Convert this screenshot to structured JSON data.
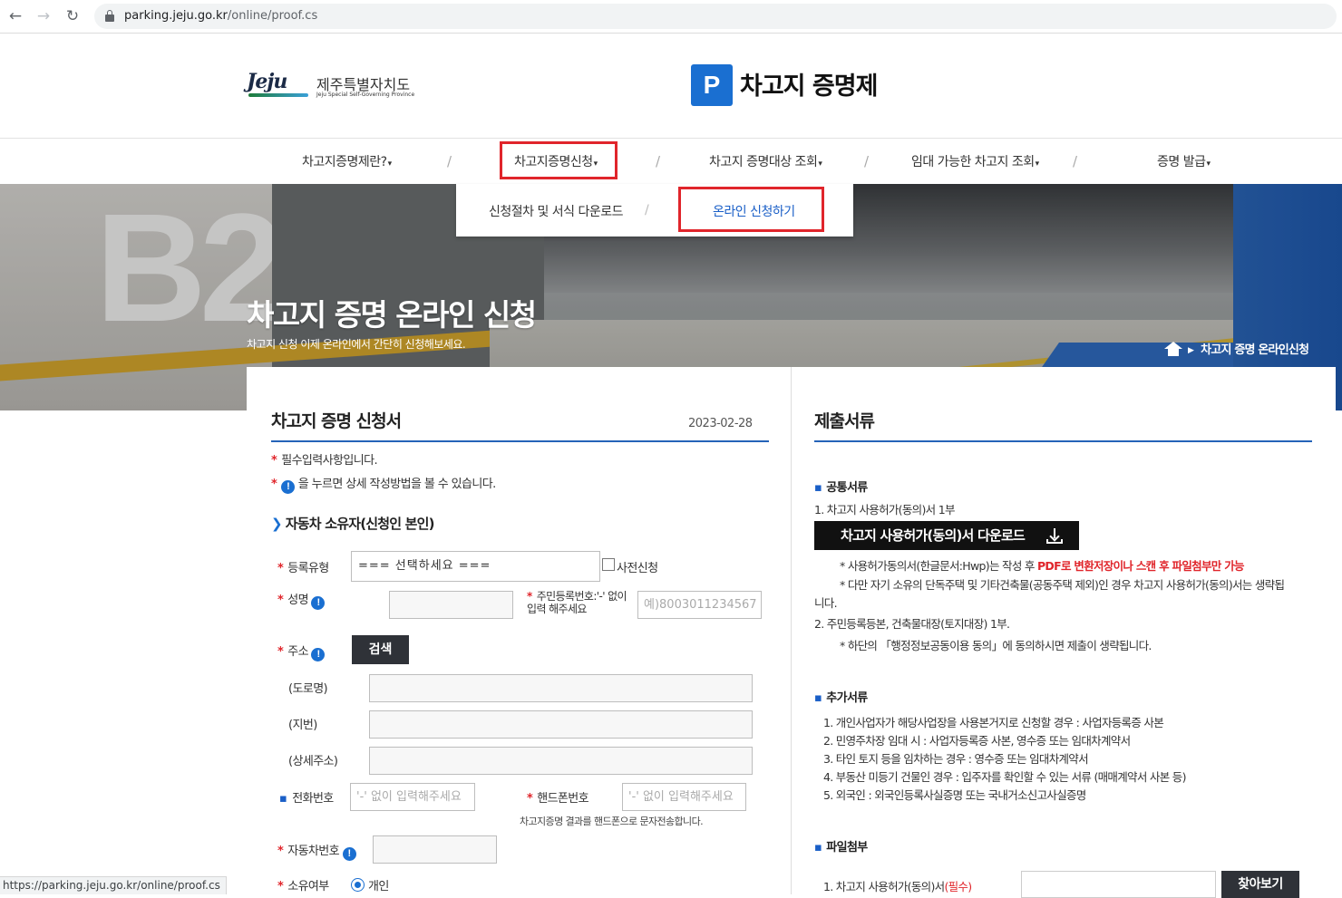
{
  "browser": {
    "url_host": "parking.jeju.go.kr",
    "url_path": "/online/proof.cs"
  },
  "header": {
    "jeju_mark": "Jeju",
    "jeju_org_kr": "제주특별자치도",
    "jeju_org_en": "Jeju Special Self-Governing Province",
    "brand_letter": "P",
    "brand_title": "차고지 증명제"
  },
  "nav": {
    "items": [
      {
        "label": "차고지증명제란?"
      },
      {
        "label": "차고지증명신청"
      },
      {
        "label": "차고지 증명대상 조회"
      },
      {
        "label": "임대 가능한 차고지 조회"
      },
      {
        "label": "증명 발급"
      }
    ],
    "caret": "▾",
    "separator": "/"
  },
  "dropdown": {
    "items": [
      {
        "label": "신청절차 및 서식 다운로드"
      },
      {
        "label": "온라인 신청하기"
      }
    ]
  },
  "hero": {
    "sign_text": "B2",
    "title": "차고지 증명 온라인 신청",
    "subtitle": "차고지 신청 이제 온라인에서 간단히 신청해보세요.",
    "breadcrumb_current": "차고지 증명 온라인신청"
  },
  "form": {
    "title": "차고지 증명 신청서",
    "date": "2023-02-28",
    "note1": "필수입력사항입니다.",
    "note2": "을 누르면 상세 작성방법을 볼 수 있습니다.",
    "info_glyph": "!",
    "section_owner": "자동차 소유자(신청인 본인)",
    "reg_type_label": "등록유형",
    "reg_type_value": "=== 선택하세요 ===",
    "pre_apply_label": "사전신청",
    "name_label": "성명",
    "rrn_label": "주민등록번호:'-' 없이 입력 해주세요",
    "rrn_placeholder": "예)8003011234567",
    "address_label": "주소",
    "search_button": "검색",
    "road_label": "(도로명)",
    "lot_label": "(지번)",
    "detail_label": "(상세주소)",
    "phone_label": "전화번호",
    "phone_placeholder": "'-' 없이 입력해주세요",
    "mobile_label": "핸드폰번호",
    "mobile_placeholder": "'-' 없이 입력해주세요",
    "mobile_note": "차고지증명 결과를 핸드폰으로 문자전송합니다.",
    "car_number_label": "자동차번호",
    "ownership_label": "소유여부",
    "ownership_option": "개인"
  },
  "docs": {
    "title": "제출서류",
    "common_heading": "공통서류",
    "common_item1": "1. 차고지 사용허가(동의)서 1부",
    "download_button": "차고지 사용허가(동의)서 다운로드",
    "note_hwp_a": "* 사용허가동의서(한글문서:Hwp)는 작성 후 ",
    "note_hwp_b": "PDF로 변환저장이나 스캔 후 파일첨부만 가능",
    "note_owner_line1": "* 다만 자기 소유의 단독주택 및 기타건축물(공동주택 제외)인 경우 차고지 사용허가(동의)서는 생략됩",
    "note_owner_line2": "니다.",
    "common_item2": "2. 주민등록등본, 건축물대장(토지대장) 1부.",
    "note_consent": "* 하단의 「행정정보공동이용 동의」에 동의하시면 제출이 생략됩니다.",
    "extra_heading": "추가서류",
    "extra_items": [
      "1. 개인사업자가 해당사업장을 사용본거지로 신청할 경우 : 사업자등록증 사본",
      "2. 민영주차장 임대 시 : 사업자등록증 사본, 영수증 또는 임대차계약서",
      "3. 타인 토지 등을 임차하는 경우 : 영수증 또는 임대차계약서",
      "4. 부동산 미등기 건물인 경우 : 입주자를 확인할 수 있는 서류 (매매계약서 사본 등)",
      "5. 외국인 : 외국인등록사실증명 또는 국내거소신고사실증명"
    ],
    "attach_heading": "파일첨부",
    "attach_item1": "1. 차고지 사용허가(동의)서",
    "attach_required": "(필수)",
    "browse_button": "찾아보기"
  },
  "status_bar": {
    "url": "https://parking.jeju.go.kr/online/proof.cs"
  },
  "colors": {
    "accent_blue": "#1a6fd1",
    "highlight_red": "#e0252b",
    "button_dark": "#2f3238"
  }
}
